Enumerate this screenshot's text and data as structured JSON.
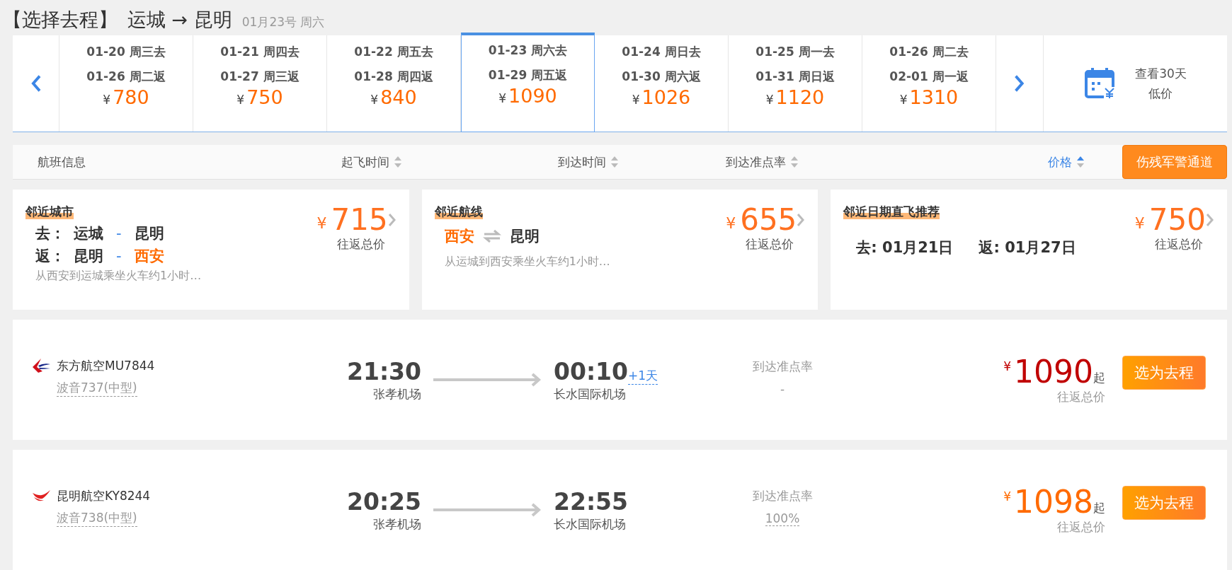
{
  "header": {
    "title": "【选择去程】",
    "route": "运城 → 昆明",
    "date": "01月23号 周六"
  },
  "date_strip": {
    "cells": [
      {
        "go": "01-20 周三去",
        "ret": "01-26 周二返",
        "currency": "¥",
        "price": "780",
        "selected": false
      },
      {
        "go": "01-21 周四去",
        "ret": "01-27 周三返",
        "currency": "¥",
        "price": "750",
        "selected": false
      },
      {
        "go": "01-22 周五去",
        "ret": "01-28 周四返",
        "currency": "¥",
        "price": "840",
        "selected": false
      },
      {
        "go": "01-23 周六去",
        "ret": "01-29 周五返",
        "currency": "¥",
        "price": "1090",
        "selected": true
      },
      {
        "go": "01-24 周日去",
        "ret": "01-30 周六返",
        "currency": "¥",
        "price": "1026",
        "selected": false
      },
      {
        "go": "01-25 周一去",
        "ret": "01-31 周日返",
        "currency": "¥",
        "price": "1120",
        "selected": false
      },
      {
        "go": "01-26 周二去",
        "ret": "02-01 周一返",
        "currency": "¥",
        "price": "1310",
        "selected": false
      }
    ],
    "calendar": {
      "line1": "查看30天",
      "line2": "低价"
    }
  },
  "sort_bar": {
    "columns": [
      {
        "label": "航班信息",
        "sortable": false,
        "selected": false
      },
      {
        "label": "起飞时间",
        "sortable": true,
        "selected": false
      },
      {
        "label": "到达时间",
        "sortable": true,
        "selected": false
      },
      {
        "label": "到达准点率",
        "sortable": true,
        "selected": false
      },
      {
        "label": "价格",
        "sortable": true,
        "selected": true
      }
    ],
    "button": "伤残军警通道"
  },
  "recommendations": [
    {
      "kind": "city",
      "title": "邻近城市",
      "lines": [
        {
          "label": "去：",
          "segments": [
            {
              "text": "运城",
              "highlight": false
            },
            {
              "text": "昆明",
              "highlight": false
            }
          ]
        },
        {
          "label": "返：",
          "segments": [
            {
              "text": "昆明",
              "highlight": false
            },
            {
              "text": "西安",
              "highlight": true
            }
          ]
        }
      ],
      "sep": "-",
      "note": "从西安到运城乘坐火车约1小时…",
      "currency": "¥",
      "price": "715",
      "price_label": "往返总价"
    },
    {
      "kind": "route",
      "title": "邻近航线",
      "segments": [
        {
          "text": "西安",
          "highlight": true
        },
        {
          "text": "昆明",
          "highlight": false
        }
      ],
      "note": "从运城到西安乘坐火车约1小时…",
      "currency": "¥",
      "price": "655",
      "price_label": "往返总价"
    },
    {
      "kind": "dates",
      "title": "邻近日期直飞推荐",
      "dates": [
        "去: 01月21日",
        "返: 01月27日"
      ],
      "currency": "¥",
      "price": "750",
      "price_label": "往返总价"
    }
  ],
  "flights": [
    {
      "airline": "东方航空MU7844",
      "kind": "swallow",
      "aircraft": "波音737(中型)",
      "dep_time": "21:30",
      "dep_airport": "张孝机场",
      "arr_time": "00:10",
      "next_day": "+1天",
      "arr_airport": "长水国际机场",
      "punctuality_label": "到达准点率",
      "punctuality": "-",
      "punctuality_dotted": false,
      "currency": "¥",
      "price": "1090",
      "from": "起",
      "price_label": "往返总价",
      "color": "#c00000",
      "button": "选为去程"
    },
    {
      "airline": "昆明航空KY8244",
      "kind": "bird",
      "aircraft": "波音738(中型)",
      "dep_time": "20:25",
      "dep_airport": "张孝机场",
      "arr_time": "22:55",
      "arr_airport": "长水国际机场",
      "punctuality_label": "到达准点率",
      "punctuality": "100%",
      "punctuality_dotted": true,
      "currency": "¥",
      "price": "1098",
      "from": "起",
      "price_label": "往返总价",
      "color": "#ff6a00",
      "button": "选为去程"
    }
  ]
}
